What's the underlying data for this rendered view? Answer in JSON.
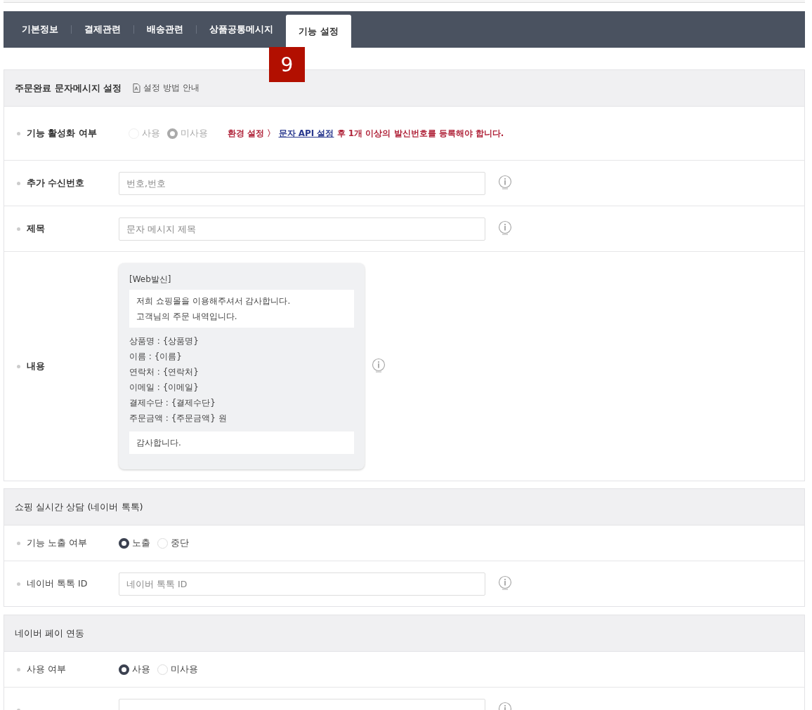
{
  "tabs": [
    {
      "label": "기본정보",
      "selected": false
    },
    {
      "label": "결제관련",
      "selected": false
    },
    {
      "label": "배송관련",
      "selected": false
    },
    {
      "label": "상품공통메시지",
      "selected": false
    },
    {
      "label": "기능 설정",
      "selected": true
    }
  ],
  "badge": "9",
  "sections": [
    {
      "title": "주문완료 문자메시지 설정",
      "emphasis": true,
      "guide": "설정 방법 안내",
      "rows": [
        {
          "kind": "radio",
          "label": "기능 활성화 여부",
          "disabled": true,
          "options": [
            {
              "label": "사용",
              "selected": false
            },
            {
              "label": "미사용",
              "selected": true
            }
          ],
          "notice": {
            "before": "환경 설정 〉 ",
            "link": "문자 API 설정",
            "after": " 후 1개 이상의 발신번호를 등록해야 합니다."
          }
        },
        {
          "kind": "input",
          "label": "추가 수신번호",
          "placeholder": "번호,번호"
        },
        {
          "kind": "input",
          "label": "제목",
          "placeholder": "문자 메시지 제목"
        },
        {
          "kind": "message",
          "label": "내용",
          "message": {
            "header": "[Web발신]",
            "intro": [
              "저희 쇼핑몰을 이용해주셔서 감사합니다.",
              "고객님의 주문 내역입니다."
            ],
            "fields": [
              "상품명 : {상품명}",
              "이름 : {이름}",
              "연락처 : {연락처}",
              "이메일 : {이메일}",
              "결제수단 : {결제수단}",
              "주문금액 : {주문금액} 원"
            ],
            "closing": "감사합니다."
          }
        }
      ]
    },
    {
      "title": "쇼핑 실시간 상담 (네이버 톡톡)",
      "emphasis": false,
      "rows": [
        {
          "kind": "radio",
          "label": "기능 노출 여부",
          "disabled": false,
          "options": [
            {
              "label": "노출",
              "selected": true
            },
            {
              "label": "중단",
              "selected": false
            }
          ]
        },
        {
          "kind": "input",
          "label": "네이버 톡톡 ID",
          "placeholder": "네이버 톡톡 ID"
        }
      ]
    },
    {
      "title": "네이버 페이 연동",
      "emphasis": false,
      "rows": [
        {
          "kind": "radio",
          "label": "사용 여부",
          "disabled": false,
          "options": [
            {
              "label": "사용",
              "selected": true
            },
            {
              "label": "미사용",
              "selected": false
            }
          ]
        },
        {
          "kind": "input"
        }
      ]
    }
  ]
}
